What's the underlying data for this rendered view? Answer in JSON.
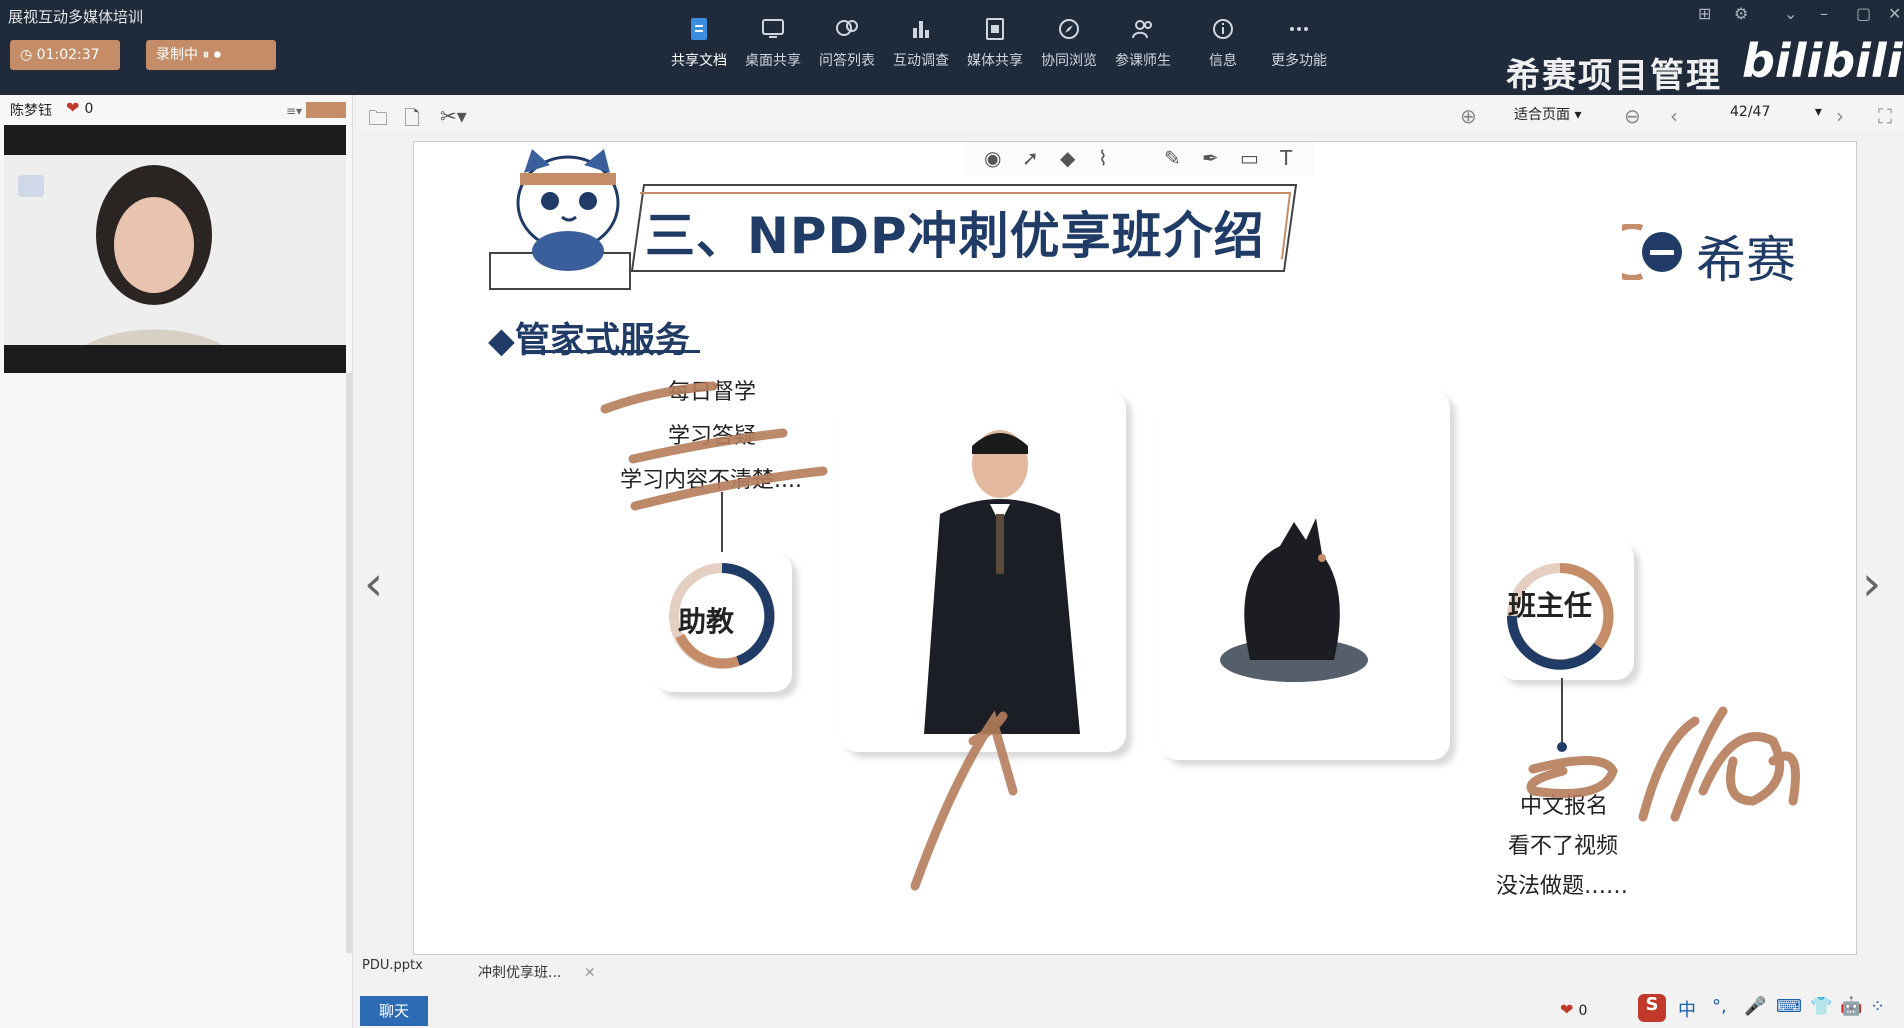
{
  "app": {
    "title": "展视互动多媒体培训"
  },
  "top": {
    "timer": "01:02:37",
    "record_label": "录制中",
    "tools": [
      "共享文档",
      "桌面共享",
      "问答列表",
      "互动调查",
      "媒体共享",
      "协同浏览",
      "参课师生",
      "信息",
      "更多功能"
    ],
    "brand": "希赛项目管理",
    "bilibili": "bilibili"
  },
  "left": {
    "user_name": "陈梦钰",
    "likes": "0"
  },
  "doc_toolbar": {
    "fit_label": "适合页面",
    "page": "42/47"
  },
  "slide": {
    "title": "三、NPDP冲刺优享班介绍",
    "logo": "希赛",
    "section": "◆管家式服务",
    "left_bullets": [
      "每日督学",
      "学习答疑",
      "学习内容不清楚...."
    ],
    "left_role": "助教",
    "right_role": "班主任",
    "right_bullets": [
      "中文报名",
      "看不了视频",
      "没法做题……"
    ]
  },
  "bottom": {
    "file_tab": "PDU.pptx",
    "doc_tab": "冲刺优享班...",
    "chat": "聊天",
    "likes": "0",
    "ime": "中"
  },
  "colors": {
    "accent": "#c58d67",
    "navy": "#1f3b66",
    "titlebar": "#1f2a3a",
    "annotation": "#b57d5c"
  }
}
